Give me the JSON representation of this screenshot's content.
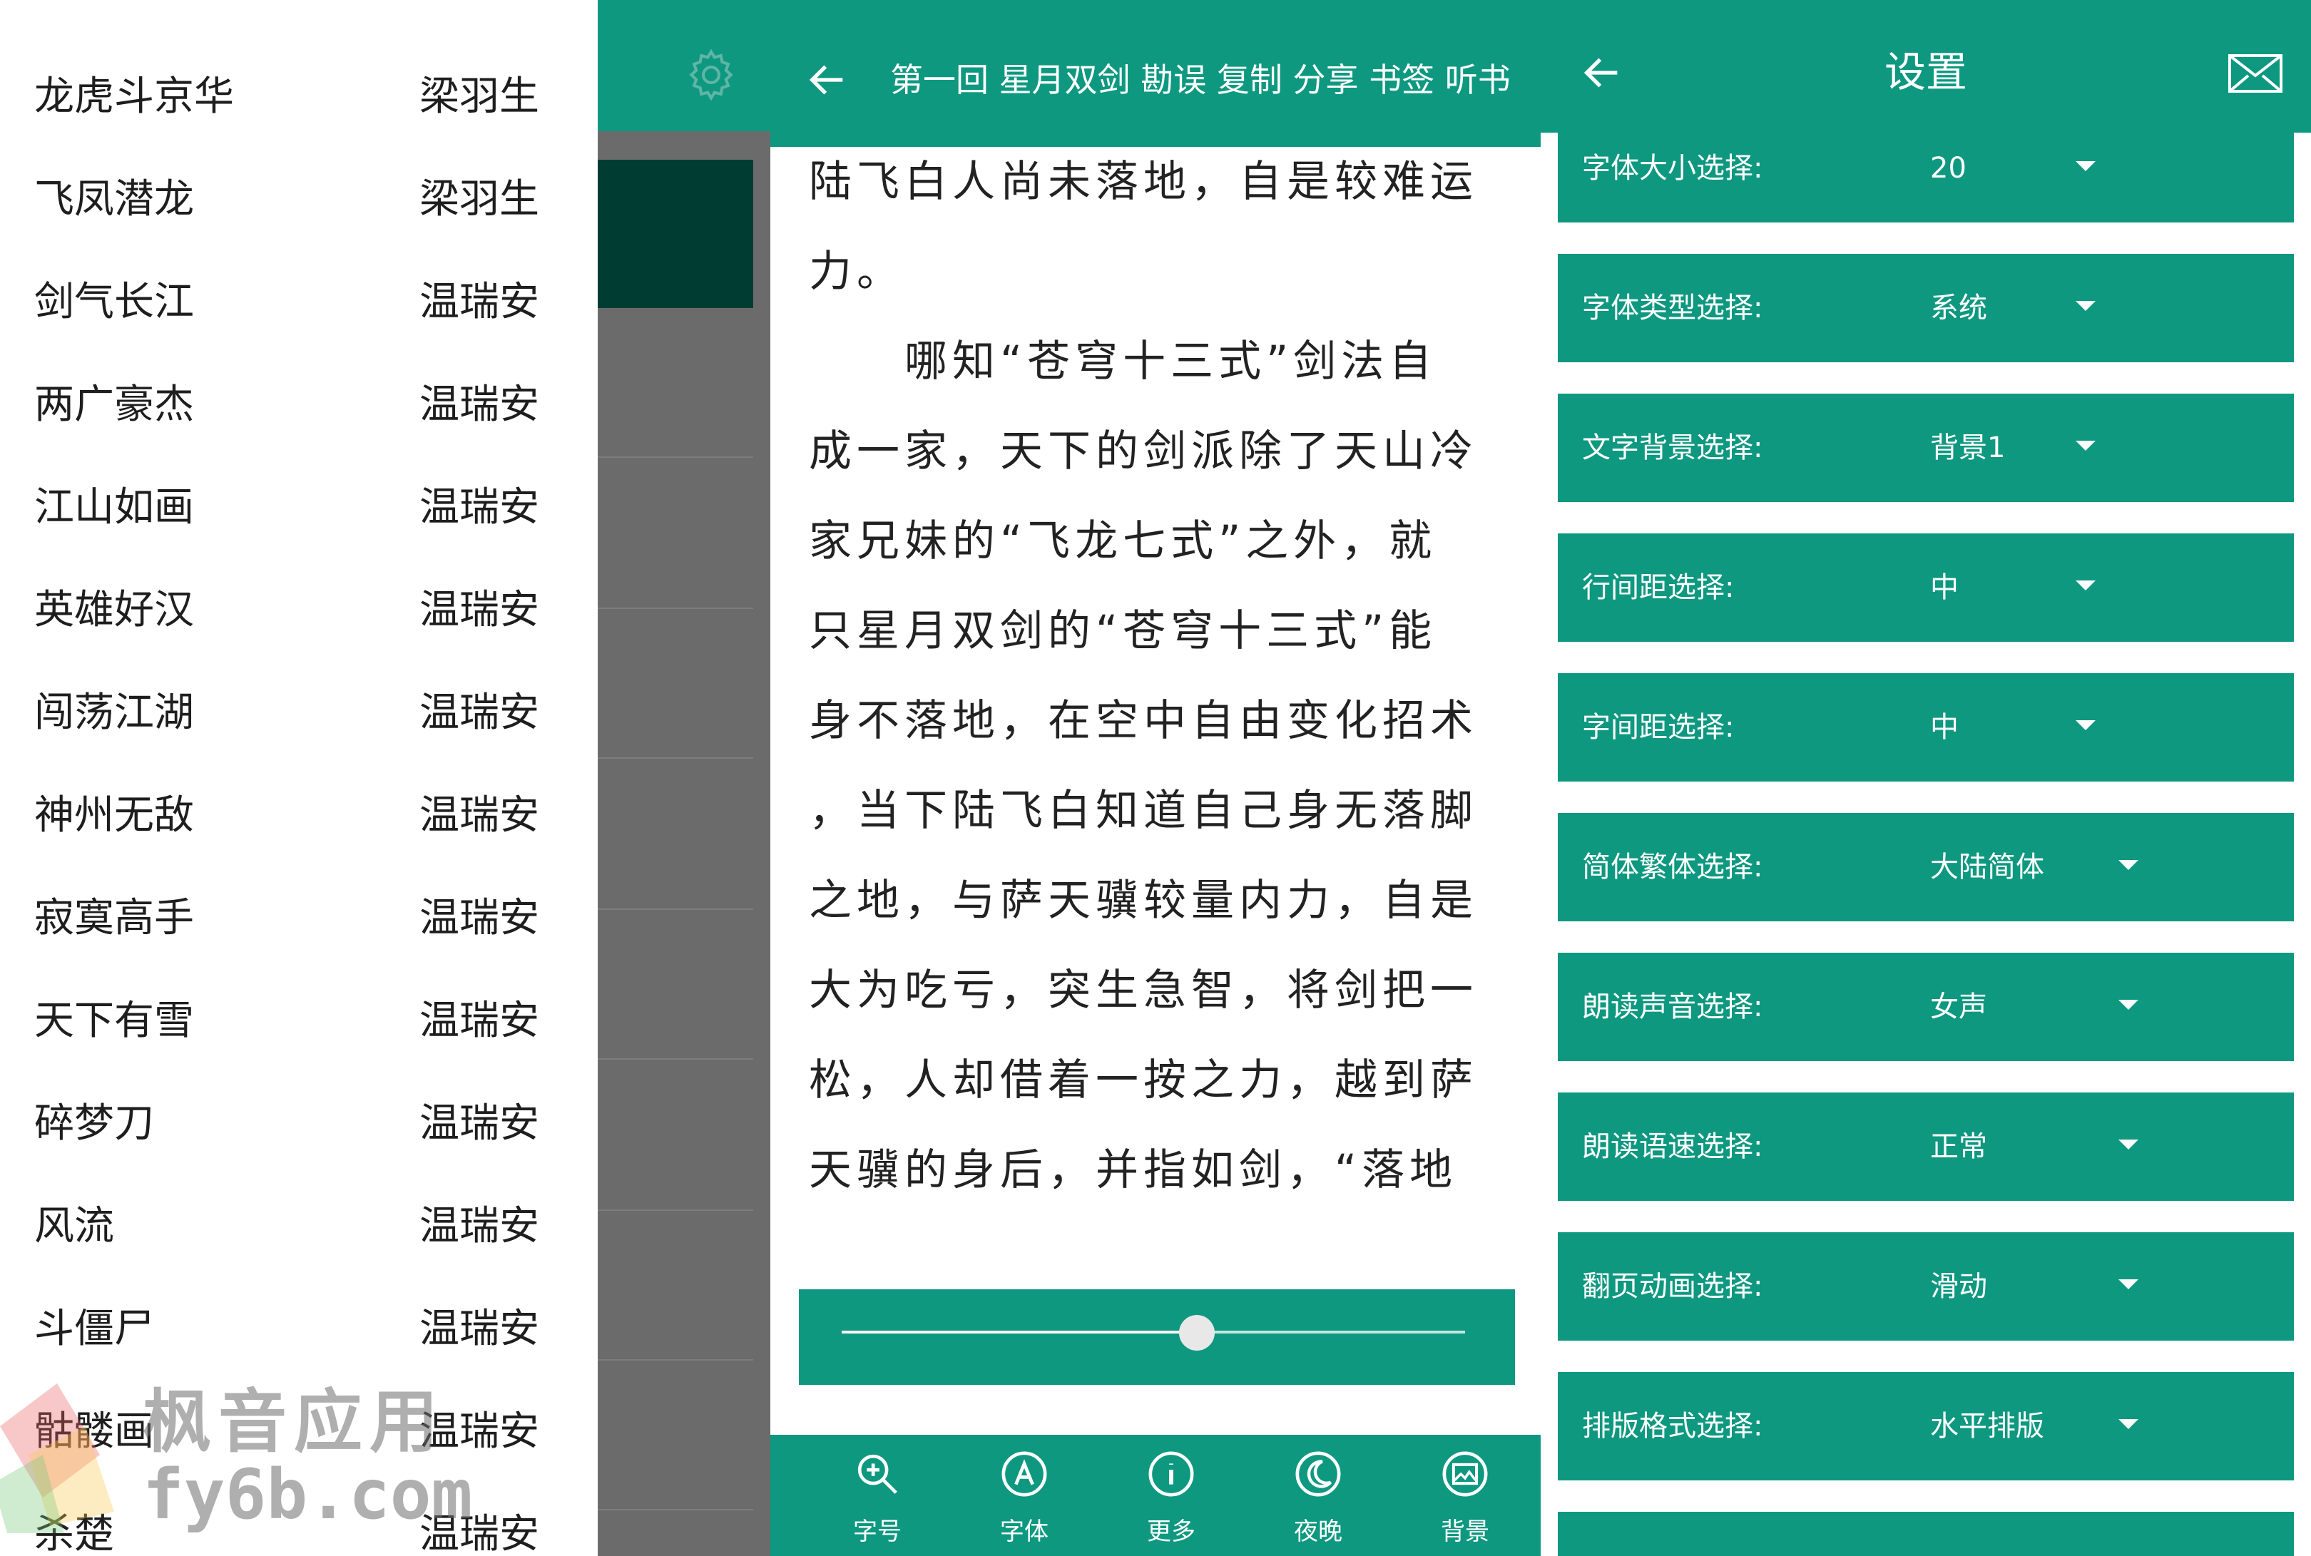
{
  "colors": {
    "accent": "#0e9880",
    "dark_card": "#003c32",
    "scrim": "#6b6b6b"
  },
  "book_list": {
    "items": [
      {
        "title": "龙虎斗京华",
        "author": "梁羽生"
      },
      {
        "title": "飞凤潜龙",
        "author": "梁羽生"
      },
      {
        "title": "剑气长江",
        "author": "温瑞安"
      },
      {
        "title": "两广豪杰",
        "author": "温瑞安"
      },
      {
        "title": "江山如画",
        "author": "温瑞安"
      },
      {
        "title": "英雄好汉",
        "author": "温瑞安"
      },
      {
        "title": "闯荡江湖",
        "author": "温瑞安"
      },
      {
        "title": "神州无敌",
        "author": "温瑞安"
      },
      {
        "title": "寂寞高手",
        "author": "温瑞安"
      },
      {
        "title": "天下有雪",
        "author": "温瑞安"
      },
      {
        "title": "碎梦刀",
        "author": "温瑞安"
      },
      {
        "title": "风流",
        "author": "温瑞安"
      },
      {
        "title": "斗僵尸",
        "author": "温瑞安"
      },
      {
        "title": "骷髅画",
        "author": "温瑞安"
      },
      {
        "title": "杀楚",
        "author": "温瑞安"
      }
    ],
    "settings_icon": "gear-icon"
  },
  "watermark": {
    "line1": "枫音应用",
    "line2": "fy6b.com"
  },
  "reader": {
    "back_icon": "arrow-left-icon",
    "header_title": "第一回 星月双剑",
    "header_actions": "勘误 复制 分享 书签 听书",
    "lines": [
      "陆飞白人尚未落地，自是较难运",
      "力。",
      "　　哪知“苍穹十三式”剑法自",
      "成一家，天下的剑派除了天山冷",
      "家兄妹的“飞龙七式”之外，就",
      "只星月双剑的“苍穹十三式”能",
      "身不落地，在空中自由变化招术",
      "，当下陆飞白知道自己身无落脚",
      "之地，与萨天骥较量内力，自是",
      "大为吃亏，突生急智，将剑把一",
      "松，人却借着一按之力，越到萨",
      "天骥的身后，并指如剑，“落地",
      "”。"
    ],
    "progress": 0.57,
    "toolbar": [
      {
        "label": "字号",
        "icon": "zoom-in-icon"
      },
      {
        "label": "字体",
        "icon": "font-icon"
      },
      {
        "label": "更多",
        "icon": "info-icon"
      },
      {
        "label": "夜晚",
        "icon": "moon-icon"
      },
      {
        "label": "背景",
        "icon": "image-icon"
      }
    ]
  },
  "settings": {
    "title": "设置",
    "back_icon": "arrow-left-icon",
    "mail_icon": "mail-icon",
    "items": [
      {
        "label": "字体大小选择:",
        "value": "20"
      },
      {
        "label": "字体类型选择:",
        "value": "系统"
      },
      {
        "label": "文字背景选择:",
        "value": "背景1"
      },
      {
        "label": "行间距选择:",
        "value": "中"
      },
      {
        "label": "字间距选择:",
        "value": "中"
      },
      {
        "label": "简体繁体选择:",
        "value": "大陆简体"
      },
      {
        "label": "朗读声音选择:",
        "value": "女声"
      },
      {
        "label": "朗读语速选择:",
        "value": "正常"
      },
      {
        "label": "翻页动画选择:",
        "value": "滑动"
      },
      {
        "label": "排版格式选择:",
        "value": "水平排版"
      }
    ]
  }
}
